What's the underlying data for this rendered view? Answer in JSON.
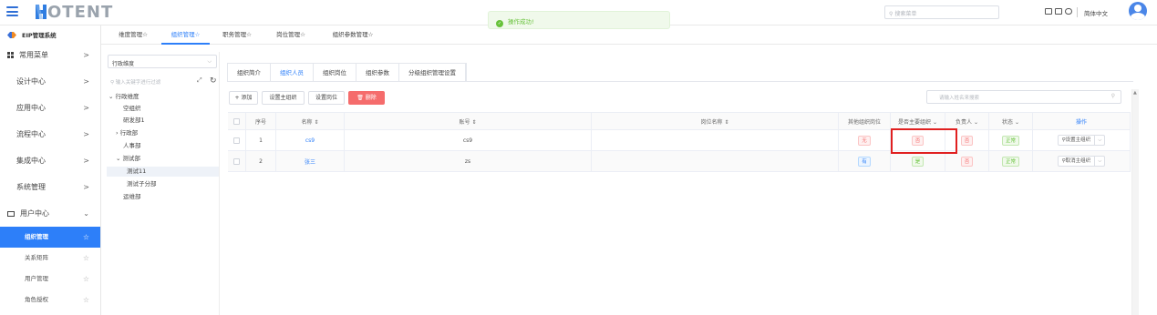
{
  "header": {
    "logo_initial": "H",
    "logo_text": "OTENT",
    "search_placeholder": "搜索菜单",
    "language": "简体中文"
  },
  "toast": {
    "message": "操作成功!"
  },
  "sidebar": {
    "system_name": "EIP管理系统",
    "menus": [
      {
        "label": "常用菜单",
        "arrow": ">"
      },
      {
        "label": "设计中心",
        "arrow": ">"
      },
      {
        "label": "应用中心",
        "arrow": ">"
      },
      {
        "label": "流程中心",
        "arrow": ">"
      },
      {
        "label": "集成中心",
        "arrow": ">"
      },
      {
        "label": "系统管理",
        "arrow": ">"
      },
      {
        "label": "用户中心",
        "arrow": "⌄"
      }
    ],
    "submenus": [
      {
        "label": "组织管理",
        "active": true
      },
      {
        "label": "关系矩阵"
      },
      {
        "label": "用户管理"
      },
      {
        "label": "角色授权"
      }
    ]
  },
  "tabs": [
    {
      "label": "维度管理☆"
    },
    {
      "label": "组织管理☆",
      "active": true
    },
    {
      "label": "职务管理☆"
    },
    {
      "label": "岗位管理☆"
    },
    {
      "label": "组织参数管理☆"
    }
  ],
  "tree": {
    "dimension_select": "行政维度",
    "search_placeholder": "输入关键字进行过滤",
    "nodes": [
      {
        "label": "⌄ 行政维度",
        "indent": 0
      },
      {
        "label": "空组织",
        "indent": 1
      },
      {
        "label": "研发部1",
        "indent": 1
      },
      {
        "label": "› 行政部",
        "indent": 1
      },
      {
        "label": "人事部",
        "indent": 1
      },
      {
        "label": "⌄ 测试部",
        "indent": 1
      },
      {
        "label": "测试11",
        "indent": 2,
        "selected": true
      },
      {
        "label": "测试子分部",
        "indent": 2
      },
      {
        "label": "运维部",
        "indent": 1
      }
    ]
  },
  "panel_tabs": [
    {
      "label": "组织简介"
    },
    {
      "label": "组织人员",
      "active": true
    },
    {
      "label": "组织岗位"
    },
    {
      "label": "组织参数"
    },
    {
      "label": "分级组织管理设置"
    }
  ],
  "toolbar": {
    "add": "+ 添加",
    "set_main_org": "设置主组织",
    "set_post": "设置岗位",
    "delete": "删除",
    "search_placeholder": "请输入姓名来搜索"
  },
  "table": {
    "headers": {
      "index": "序号",
      "name": "名称 ⇕",
      "account": "账号 ⇕",
      "post_name": "岗位名称 ⇕",
      "other_org_post": "其他组织岗位",
      "is_main_org": "是否主要组织 ⌄",
      "leader": "负责人 ⌄",
      "status": "状态 ⌄",
      "action": "操作"
    },
    "rows": [
      {
        "index": "1",
        "name": "cs9",
        "account": "cs9",
        "post_name": "",
        "other_org_post": "无",
        "other_color": "red",
        "is_main_org": "否",
        "main_color": "red",
        "leader": "否",
        "status": "正常",
        "action": "设置主组织"
      },
      {
        "index": "2",
        "name": "张三",
        "account": "zs",
        "post_name": "",
        "other_org_post": "有",
        "other_color": "blue",
        "is_main_org": "是",
        "main_color": "green",
        "leader": "否",
        "status": "正常",
        "action": "取消主组织"
      }
    ]
  }
}
